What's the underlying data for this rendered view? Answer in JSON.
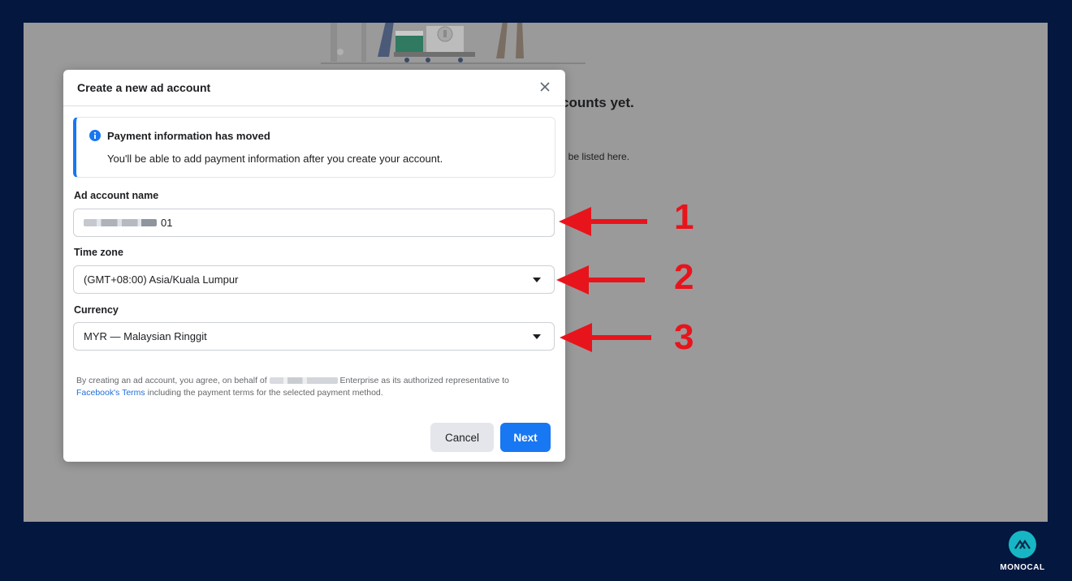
{
  "background_page": {
    "heading": "counts yet.",
    "subtext": "ll be listed here."
  },
  "modal": {
    "title": "Create a new ad account",
    "close_icon": "close-icon",
    "notice": {
      "icon": "info-icon",
      "title": "Payment information has moved",
      "body": "You'll be able to add payment information after you create your account."
    },
    "ad_account_name": {
      "label": "Ad account name",
      "value_suffix": "01"
    },
    "time_zone": {
      "label": "Time zone",
      "value": "(GMT+08:00) Asia/Kuala Lumpur"
    },
    "currency": {
      "label": "Currency",
      "value": "MYR — Malaysian Ringgit"
    },
    "terms": {
      "part1": "By creating an ad account, you agree, on behalf of",
      "part2": "Enterprise as its authorized representative to",
      "link": "Facebook's Terms",
      "part3": "including the payment terms for the selected payment method."
    },
    "buttons": {
      "cancel": "Cancel",
      "next": "Next"
    }
  },
  "annotations": {
    "color": "#e8141c",
    "steps": [
      "1",
      "2",
      "3"
    ]
  },
  "brand": {
    "name": "MONOCAL",
    "color": "#17b6c4"
  },
  "colors": {
    "frame": "#03173f",
    "accent": "#1877f2",
    "overlay": "#9a9a9a"
  }
}
